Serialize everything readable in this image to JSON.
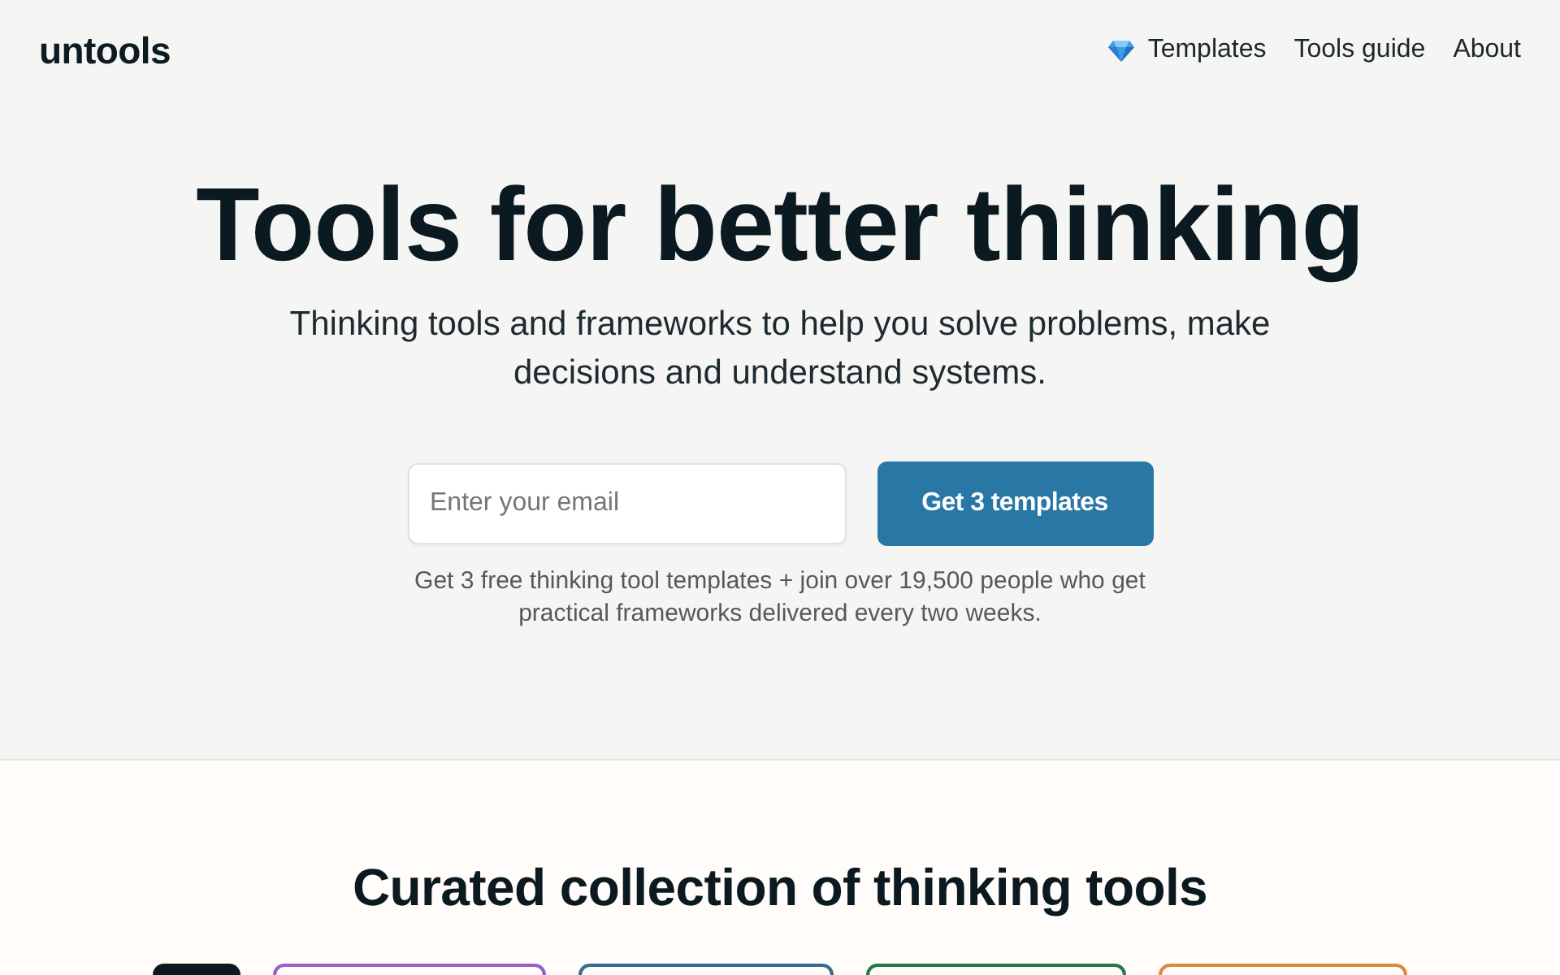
{
  "header": {
    "logo": "untools",
    "nav": [
      {
        "label": "Templates",
        "kind": "featured"
      },
      {
        "label": "Tools guide",
        "kind": "plain"
      },
      {
        "label": "About",
        "kind": "plain"
      }
    ]
  },
  "hero": {
    "title": "Tools for better thinking",
    "subtitle": "Thinking tools and frameworks to help you solve problems, make decisions and understand systems.",
    "email": {
      "placeholder": "Enter your email"
    },
    "button": "Get 3 templates",
    "note": "Get 3 free thinking tool templates + join over 19,500 people who get practical frameworks delivered every two weeks."
  },
  "collection": {
    "title": "Curated collection of thinking tools",
    "categories": [
      {
        "selected": true,
        "color": "#0b1a20"
      },
      {
        "selected": false,
        "color": "#9a5fc8"
      },
      {
        "selected": false,
        "color": "#2f6e8e"
      },
      {
        "selected": false,
        "color": "#1f7a46"
      },
      {
        "selected": false,
        "color": "#d98b3c"
      }
    ]
  }
}
